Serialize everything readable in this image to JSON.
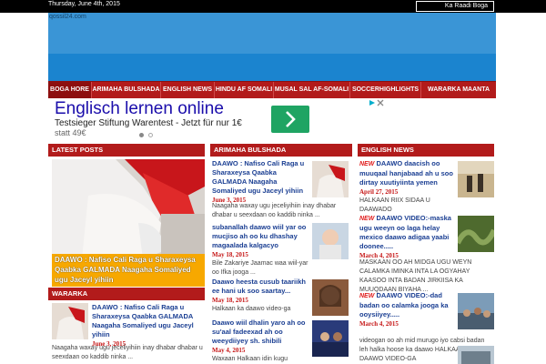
{
  "topbar": {
    "date": "Thursday, June 4th, 2015",
    "search_label": "Ka Raadi Boga"
  },
  "header": {
    "site_url": "qossil24.com"
  },
  "nav": [
    "BOGA HORE",
    "ARIMAHA BULSHADA",
    "ENGLISH NEWS",
    "HINDU AF SOMALI",
    "MUSAL SAL AF-SOMALI",
    "SOCCERHIGHLIGHTS",
    "WARARKA MAANTA"
  ],
  "ad": {
    "title": "Englisch lernen online",
    "subtitle": "Testsieger Stiftung Warentest - Jetzt für nur 1€",
    "subtitle2": "statt 49€",
    "go_icon": "chevron-right",
    "colors": {
      "green": "#1fa463",
      "title": "#1a0dab"
    }
  },
  "columns": {
    "latest": {
      "heading": "LATEST POSTS"
    },
    "arimaha": {
      "heading": "ARIMAHA BULSHADA"
    },
    "english": {
      "heading": "ENGLISH NEWS"
    },
    "wararka": {
      "heading": "WARARKA"
    }
  },
  "hero": {
    "caption": "DAAWO : Nafiso Cali Raga u Sharaxeysa Qaabka GALMADA Naagaha Somaliyed ugu Jaceyl yihiin"
  },
  "wararka_post": {
    "title": "DAAWO : Nafiso Cali Raga u Sharaxeysa Qaabka GALMADA Naagaha Somaliyed ugu Jaceyl yihiin",
    "date": "June 3, 2015",
    "excerpt": "Naagaha waxay ugu jeceliyihiin inay dhabar dhabar u seexdaan oo kaddib ninka ..."
  },
  "arimaha_posts": [
    {
      "title": "DAAWO : Nafiso Cali Raga u Sharaxeysa Qaabka GALMADA Naagaha Somaliyed ugu Jaceyl yihiin",
      "date": "June 3, 2015",
      "excerpt": "Naagaha waxay ugu jeceliyihiin inay dhabar dhabar u seexdaan oo kaddib ninka ..."
    },
    {
      "title": "subanallah daawo wiil yar oo mucjiso ah oo ku dhashay magaalada kalgacyo",
      "date": "May 18, 2015",
      "excerpt": "Bile Zakariye Jaamac waa wiil-yar oo Ifka jooga ..."
    },
    {
      "title": "Daawo heesta cusub taariikh ee hani uk soo saartay...",
      "date": "May 18, 2015",
      "excerpt": "Halkaan ka daawo video-ga"
    },
    {
      "title": "Daawo wiil dhalin yaro ah oo su'aal fadeexad ah oo weeydiiyey sh. shibili",
      "date": "May 4, 2015",
      "excerpt": "Waxaan Halkaan idin kugu"
    }
  ],
  "english_posts": [
    {
      "badge": "NEW",
      "title": "DAAWO daacish oo muuqaal hanjabaad ah u soo dirtay xuutiyiinta yemen",
      "date": "April 27, 2015",
      "excerpt": "HALKAAN RIIX SIDAA U DAAWADO"
    },
    {
      "badge": "NEW",
      "title": "DAAWO VIDEO:-maska ugu weeyn oo laga helay mexico daawo adigaa yaabi doonee.....",
      "date": "March 4, 2015",
      "excerpt": "MASKAAN OO AH MIDGA UGU WEYN CALAMKA IMINKA INTA LA OGYAHAY KAASOO INTA BADAN JIRKIISA KA MUUQDAAN BIYAHA ..."
    },
    {
      "badge": "NEW",
      "title": "DAAWO VIDEO:-dad badan oo calamka jooga ka ooysiiyey.....",
      "date": "March 4, 2015",
      "excerpt": "videogan oo ah mid murugo iyo cabsi badan leh halka hoose ka daawo HALKAAN KA DAAWO VIDEO-GA"
    }
  ]
}
